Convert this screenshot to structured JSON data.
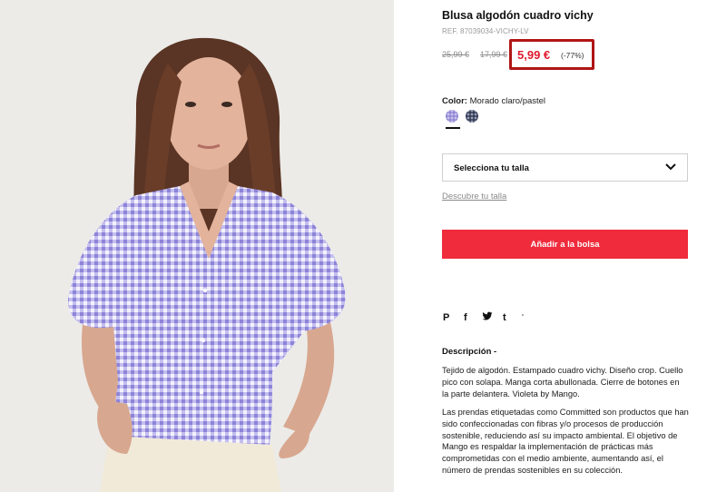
{
  "product": {
    "title": "Blusa algodón cuadro vichy",
    "reference": "REF. 87039034-VICHY-LV",
    "price_original_1": "25,99 €",
    "price_original_2": "17,99 €",
    "price_current": "5,99 €",
    "discount": "(-77%)"
  },
  "color": {
    "label": "Color:",
    "value": "Morado claro/pastel",
    "swatches": [
      {
        "name": "Morado claro/pastel",
        "color": "#c9c2ee",
        "selected": true
      },
      {
        "name": "dark-check",
        "color": "#3a4260",
        "selected": false
      }
    ]
  },
  "size": {
    "select_label": "Selecciona tu talla",
    "guide_link": "Descubre tu talla"
  },
  "actions": {
    "add_to_bag": "Añadir a la bolsa"
  },
  "share": {
    "pinterest": "P",
    "facebook": "f",
    "twitter": "🐦",
    "tumblr": "t",
    "more": "'"
  },
  "description": {
    "heading": "Descripción -",
    "paragraph_1": "Tejido de algodón. Estampado cuadro vichy. Diseño crop. Cuello pico con solapa. Manga corta abullonada. Cierre de botones en la parte delantera. Violeta by Mango.",
    "paragraph_2": "Las prendas etiquetadas como Committed son productos que han sido confeccionadas con fibras y/o procesos de producción sostenible, reduciendo así su impacto ambiental. El objetivo de Mango es respaldar la implementación de prácticas más comprometidas con el medio ambiente, aumentando así, el número de prendas sostenibles en su colección."
  },
  "colors": {
    "accent_red": "#ef2b3c",
    "price_red": "#e0192c",
    "highlight_border": "#b01515",
    "shirt_lilac": "#b8b2e6"
  }
}
